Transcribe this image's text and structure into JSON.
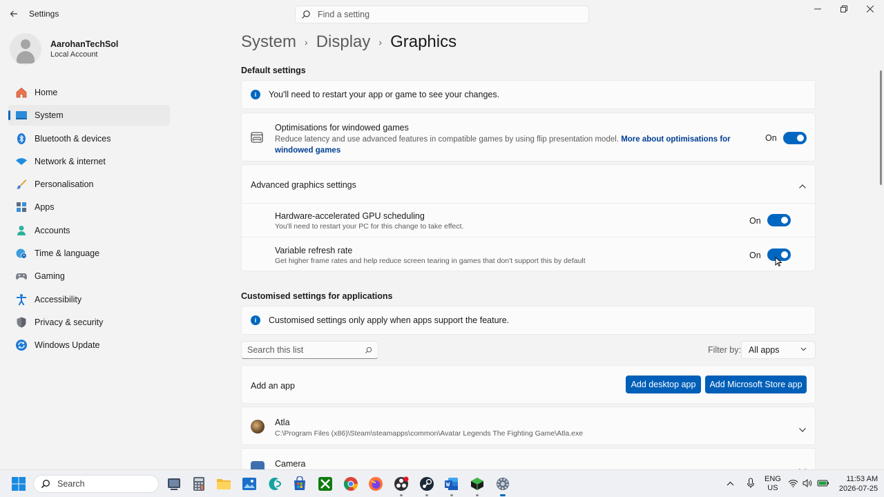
{
  "window": {
    "back_icon": "back-arrow-icon",
    "title": "Settings",
    "search_placeholder": "Find a setting",
    "controls": [
      "minimize-icon",
      "restore-icon",
      "close-icon"
    ]
  },
  "profile": {
    "name": "AarohanTechSol",
    "account_type": "Local Account"
  },
  "sidebar": {
    "items": [
      {
        "label": "Home",
        "icon": "home-icon"
      },
      {
        "label": "System",
        "icon": "system-icon",
        "active": true
      },
      {
        "label": "Bluetooth & devices",
        "icon": "bluetooth-icon"
      },
      {
        "label": "Network & internet",
        "icon": "wifi-icon"
      },
      {
        "label": "Personalisation",
        "icon": "brush-icon"
      },
      {
        "label": "Apps",
        "icon": "apps-icon"
      },
      {
        "label": "Accounts",
        "icon": "accounts-icon"
      },
      {
        "label": "Time & language",
        "icon": "globe-clock-icon"
      },
      {
        "label": "Gaming",
        "icon": "gamepad-icon"
      },
      {
        "label": "Accessibility",
        "icon": "accessibility-icon"
      },
      {
        "label": "Privacy & security",
        "icon": "shield-icon"
      },
      {
        "label": "Windows Update",
        "icon": "update-icon"
      }
    ]
  },
  "breadcrumb": {
    "items": [
      "System",
      "Display"
    ],
    "current": "Graphics"
  },
  "default_settings": {
    "title": "Default settings",
    "info": "You'll need to restart your app or game to see your changes.",
    "windowed_games": {
      "title": "Optimisations for windowed games",
      "description": "Reduce latency and use advanced features in compatible games by using flip presentation model.",
      "link": "More about optimisations for windowed games",
      "state": "On",
      "enabled": true
    }
  },
  "advanced": {
    "title": "Advanced graphics settings",
    "expanded": true,
    "settings": [
      {
        "title": "Hardware-accelerated GPU scheduling",
        "description": "You'll need to restart your PC for this change to take effect.",
        "state": "On",
        "enabled": true
      },
      {
        "title": "Variable refresh rate",
        "description": "Get higher frame rates and help reduce screen tearing in games that don't support this by default",
        "state": "On",
        "enabled": true
      }
    ]
  },
  "custom": {
    "title": "Customised settings for applications",
    "info": "Customised settings only apply when apps support the feature.",
    "search_placeholder": "Search this list",
    "filter_label": "Filter by:",
    "filter_value": "All apps",
    "add_app_label": "Add an app",
    "add_desktop_button": "Add desktop app",
    "add_store_button": "Add Microsoft Store app",
    "apps": [
      {
        "name": "Atla",
        "path": "C:\\Program Files (x86)\\Steam\\steamapps\\common\\Avatar Legends The Fighting Game\\Atla.exe"
      },
      {
        "name": "Camera",
        "path": ""
      }
    ]
  },
  "taskbar": {
    "search_label": "Search",
    "apps": [
      "task-view-icon",
      "calculator-icon",
      "file-explorer-icon",
      "photos-icon",
      "vpn-app-icon",
      "store-icon",
      "xbox-icon",
      "chrome-icon",
      "firefox-icon",
      "obs-icon",
      "steam-icon",
      "word-icon",
      "game-app-icon",
      "settings-icon"
    ],
    "language": "ENG",
    "region": "US",
    "time": "11:53 AM",
    "date": "2026-07-25"
  },
  "colors": {
    "accent": "#0067c0",
    "button": "#005fb8",
    "link": "#003e92"
  }
}
